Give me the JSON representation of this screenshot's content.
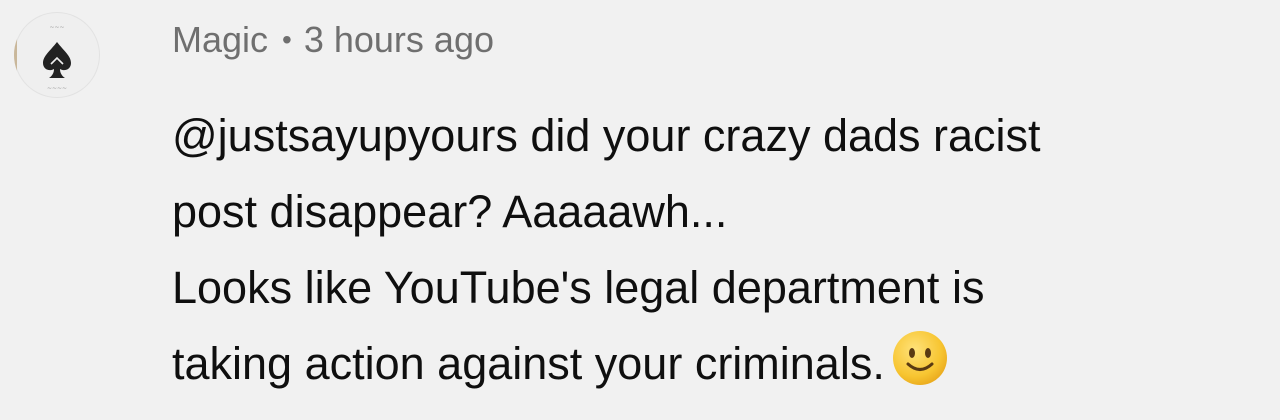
{
  "comment": {
    "author": "Magic",
    "separator": "•",
    "timestamp": "3 hours ago",
    "avatar_icon": "spade-icon",
    "lines": [
      "@justsayupyours did your crazy dads racist",
      "post disappear? Aaaaawh...",
      "Looks like YouTube's legal department is",
      "taking action against your criminals."
    ],
    "emoji": "slightly-smiling-face-icon"
  },
  "colors": {
    "background": "#f1f1f1",
    "meta_text": "#6f6f6f",
    "body_text": "#0f0f0f",
    "emoji_yellow": "#f7c531"
  }
}
